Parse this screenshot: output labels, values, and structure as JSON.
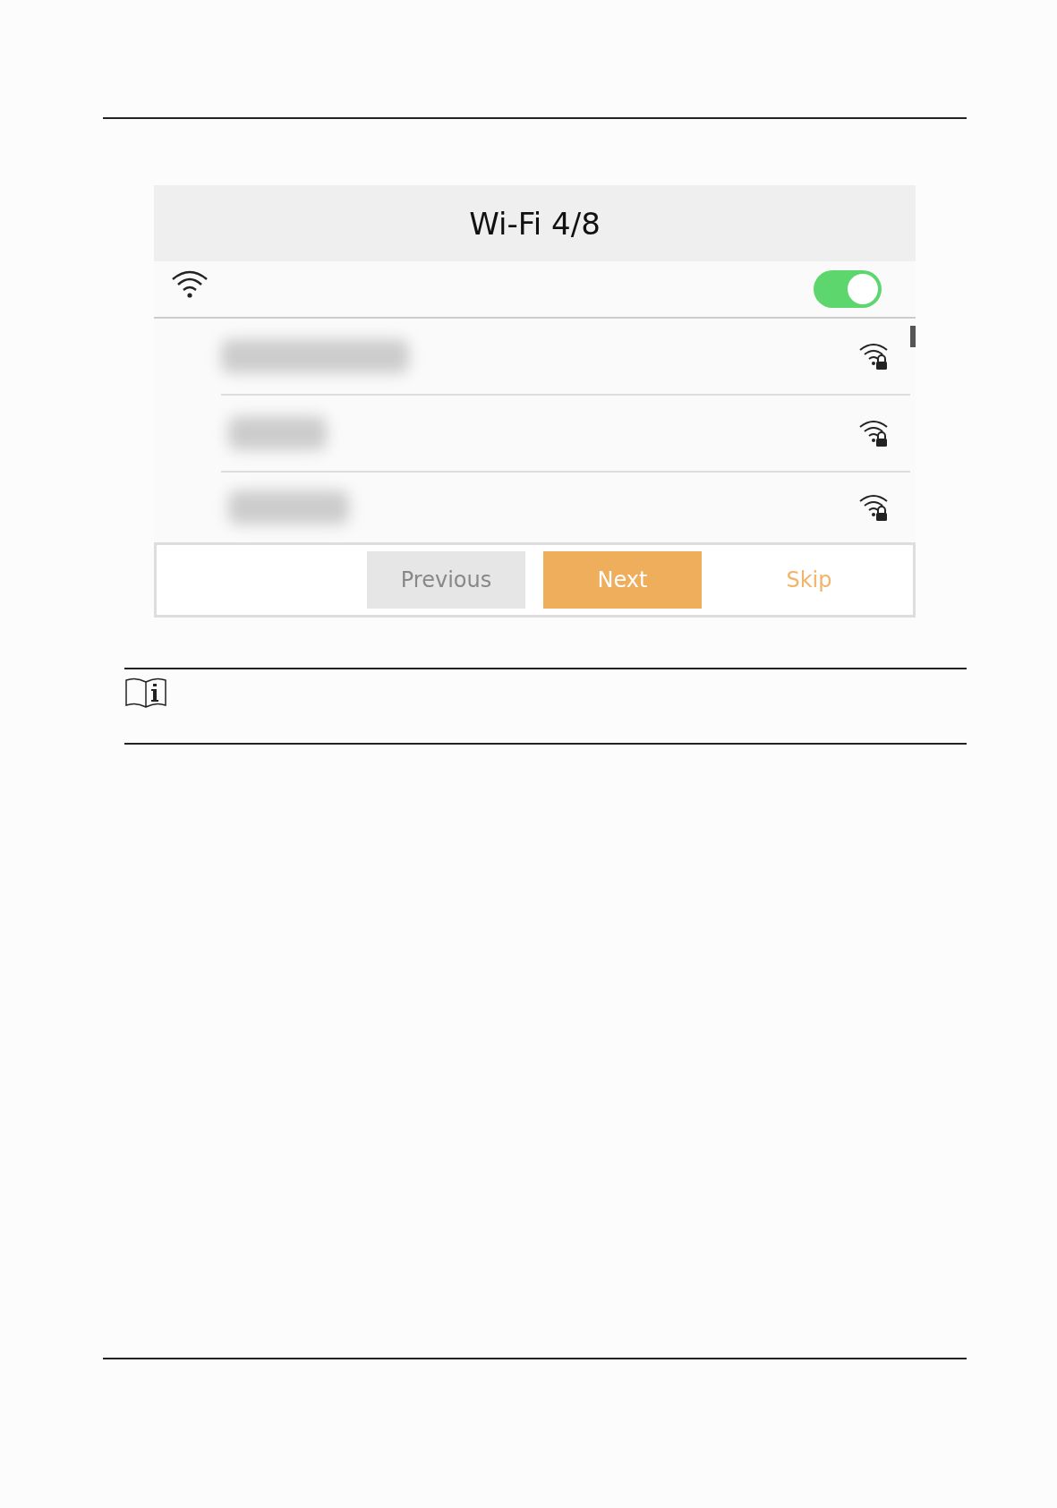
{
  "screen": {
    "title": "Wi-Fi 4/8",
    "wifi_switch": {
      "on": true
    },
    "networks": [
      {
        "secured": true
      },
      {
        "secured": true
      },
      {
        "secured": true
      }
    ],
    "buttons": [
      {
        "label": "Previous",
        "kind": "secondary"
      },
      {
        "label": "Next",
        "kind": "primary"
      },
      {
        "label": "Skip",
        "kind": "link"
      }
    ]
  }
}
